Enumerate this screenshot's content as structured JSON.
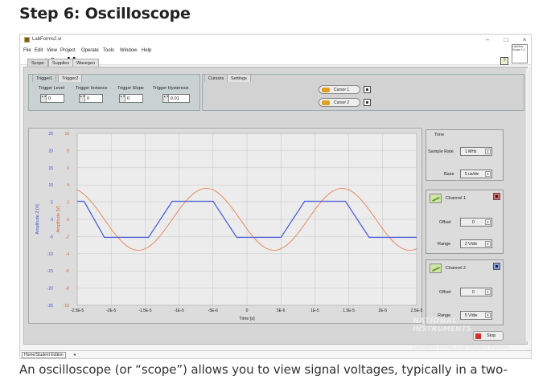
{
  "article": {
    "heading": "Step 6: Oscilloscope",
    "caption": "An oscilloscope (or “scope”) allows you to view signal voltages, typically in a two-"
  },
  "window": {
    "title": "LabForms2.vi",
    "controls": {
      "minimize": "–",
      "maximize": "□",
      "close": "×"
    },
    "menu": [
      "File",
      "Edit",
      "View",
      "Project",
      "Operate",
      "Tools",
      "Window",
      "Help"
    ],
    "vi_icon_text": "LabView Scope 1.0",
    "help_icon": "?"
  },
  "tabs": {
    "main": [
      "Scope",
      "Supplies",
      "Wavegen"
    ],
    "main_active": "Scope",
    "trigger": [
      "Trigger1",
      "Trigger2"
    ],
    "cursor": [
      "Cursors",
      "Settings"
    ]
  },
  "trigger": {
    "level": {
      "label": "Trigger Level",
      "value": "0"
    },
    "instance": {
      "label": "Trigger Instance",
      "value": "0"
    },
    "slope": {
      "label": "Trigger Slope",
      "value": "0"
    },
    "hysteresis": {
      "label": "Trigger Hysteresis",
      "value": "0.01"
    }
  },
  "cursors": [
    {
      "label": "Cursor 1"
    },
    {
      "label": "Cursor 2"
    }
  ],
  "right_panel": {
    "time_title": "Time",
    "sample_rate": {
      "label": "Sample Rate",
      "value": "1 MHz"
    },
    "base": {
      "label": "Base",
      "value": "5 us/div"
    },
    "channel1": {
      "title": "Channel 1",
      "offset_label": "Offset",
      "offset_value": "0",
      "range_label": "Range",
      "range_value": "2 V/div"
    },
    "channel2": {
      "title": "Channel 2",
      "offset_label": "Offset",
      "offset_value": "0",
      "range_label": "Range",
      "range_value": "5 V/div"
    }
  },
  "footer": {
    "ni_line1": "NATIONAL",
    "ni_line2": "INSTRUMENTS",
    "labview_text": "LabVIEW Home and Student Edition",
    "stop_label": "Stop",
    "edition_label": "Home/Student Edition",
    "edition_arrow": "◂"
  },
  "chart_data": {
    "type": "line",
    "xlabel": "Time [s]",
    "ylabel_left": "Amplitude 2 [V]",
    "ylabel_right": "Amplitude [V]",
    "xlim": [
      -2.5e-05,
      2.5e-05
    ],
    "x_ticks": [
      "-2.5E-5",
      "-2E-5",
      "-1.5E-5",
      "-1E-5",
      "-5E-6",
      "0",
      "5E-6",
      "1E-5",
      "1.5E-5",
      "2E-5",
      "2.5E-5"
    ],
    "y2_ticks": [
      "25",
      "20",
      "15",
      "10",
      "5",
      "0",
      "-5",
      "-10",
      "-15",
      "-20",
      "-25"
    ],
    "y1_ticks": [
      "10",
      "8",
      "6",
      "4",
      "2",
      "0",
      "-2",
      "-4",
      "-6",
      "-8",
      "-10"
    ],
    "y1lim": [
      -10,
      10
    ],
    "grid": true,
    "series": [
      {
        "color": "#4a5fe0",
        "axis": "right",
        "x": [
          -2.5e-05,
          -2.4e-05,
          -2.1e-05,
          -1.45e-05,
          -1.4e-05,
          -1.1e-05,
          -5e-06,
          -4.5e-06,
          -1.5e-06,
          5e-06,
          5.5e-06,
          8.5e-06,
          1.45e-05,
          1.5e-05,
          1.8e-05,
          2.5e-05
        ],
        "y": [
          2.1,
          2.1,
          -2.1,
          -2.1,
          -1.5,
          2.1,
          2.1,
          1.5,
          -2.1,
          -2.1,
          -1.5,
          2.1,
          2.1,
          1.5,
          -2.1,
          -2.1
        ]
      },
      {
        "color": "#e88a60",
        "axis": "right",
        "amplitude": 3.6,
        "period": 2e-05,
        "peaks": [
          -6e-06,
          1.4e-05
        ],
        "troughs": [
          -1.6e-05,
          4e-06
        ]
      }
    ]
  }
}
